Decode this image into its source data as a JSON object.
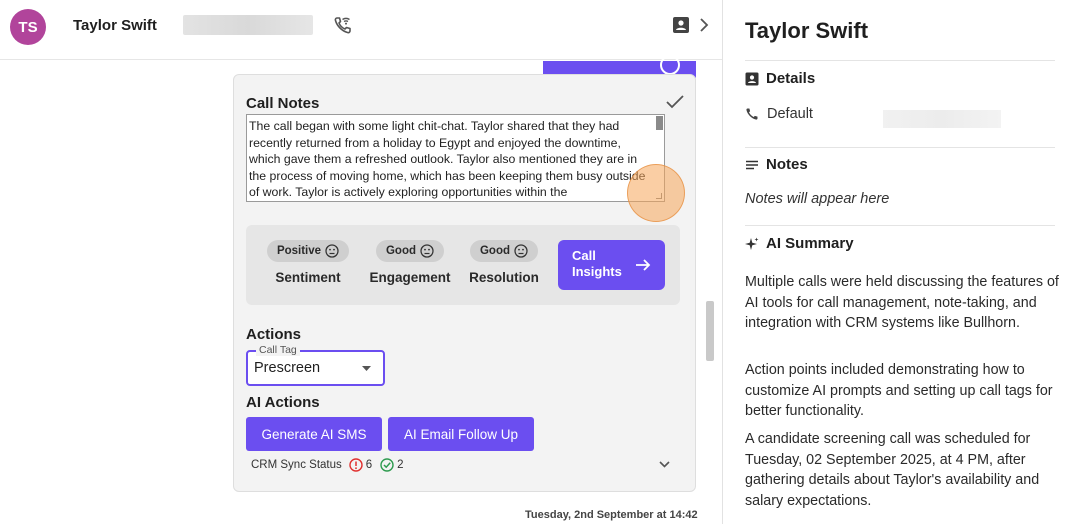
{
  "header": {
    "avatar_initials": "TS",
    "contact_name": "Taylor Swift"
  },
  "call_notes": {
    "title": "Call Notes",
    "text": "The call began with some light chit-chat. Taylor shared that they had recently returned from a holiday to Egypt and enjoyed the downtime, which gave them a refreshed outlook. Taylor also mentioned they are in the process of moving home, which has been keeping them busy outside of work. Taylor is actively exploring opportunities within the"
  },
  "insights": {
    "metrics": [
      {
        "value": "Positive",
        "label": "Sentiment"
      },
      {
        "value": "Good",
        "label": "Engagement"
      },
      {
        "value": "Good",
        "label": "Resolution"
      }
    ],
    "button_label_line1": "Call",
    "button_label_line2": "Insights"
  },
  "actions": {
    "title": "Actions",
    "call_tag_label": "Call Tag",
    "call_tag_value": "Prescreen"
  },
  "ai_actions": {
    "title": "AI Actions",
    "sms_button": "Generate AI SMS",
    "email_button": "AI Email Follow Up",
    "sync_status_label": "CRM Sync Status",
    "error_count": "6",
    "success_count": "2"
  },
  "timestamp": "Tuesday, 2nd September at 14:42",
  "panel": {
    "title": "Taylor Swift",
    "details_heading": "Details",
    "default_label": "Default",
    "notes_heading": "Notes",
    "notes_placeholder": "Notes will appear here",
    "ai_summary_heading": "AI Summary",
    "summary_paragraphs": [
      "Multiple calls were held discussing the features of AI tools for call management, note-taking, and integration with CRM systems like Bullhorn.",
      "Action points included demonstrating how to customize AI prompts and setting up call tags for better functionality.",
      "A candidate screening call was scheduled for Tuesday, 02 September 2025, at 4 PM, after gathering details about Taylor's availability and salary expectations."
    ]
  },
  "colors": {
    "accent": "#6b4ef0",
    "avatar": "#b1449b",
    "error": "#e0302f",
    "success": "#2e9b4f"
  }
}
